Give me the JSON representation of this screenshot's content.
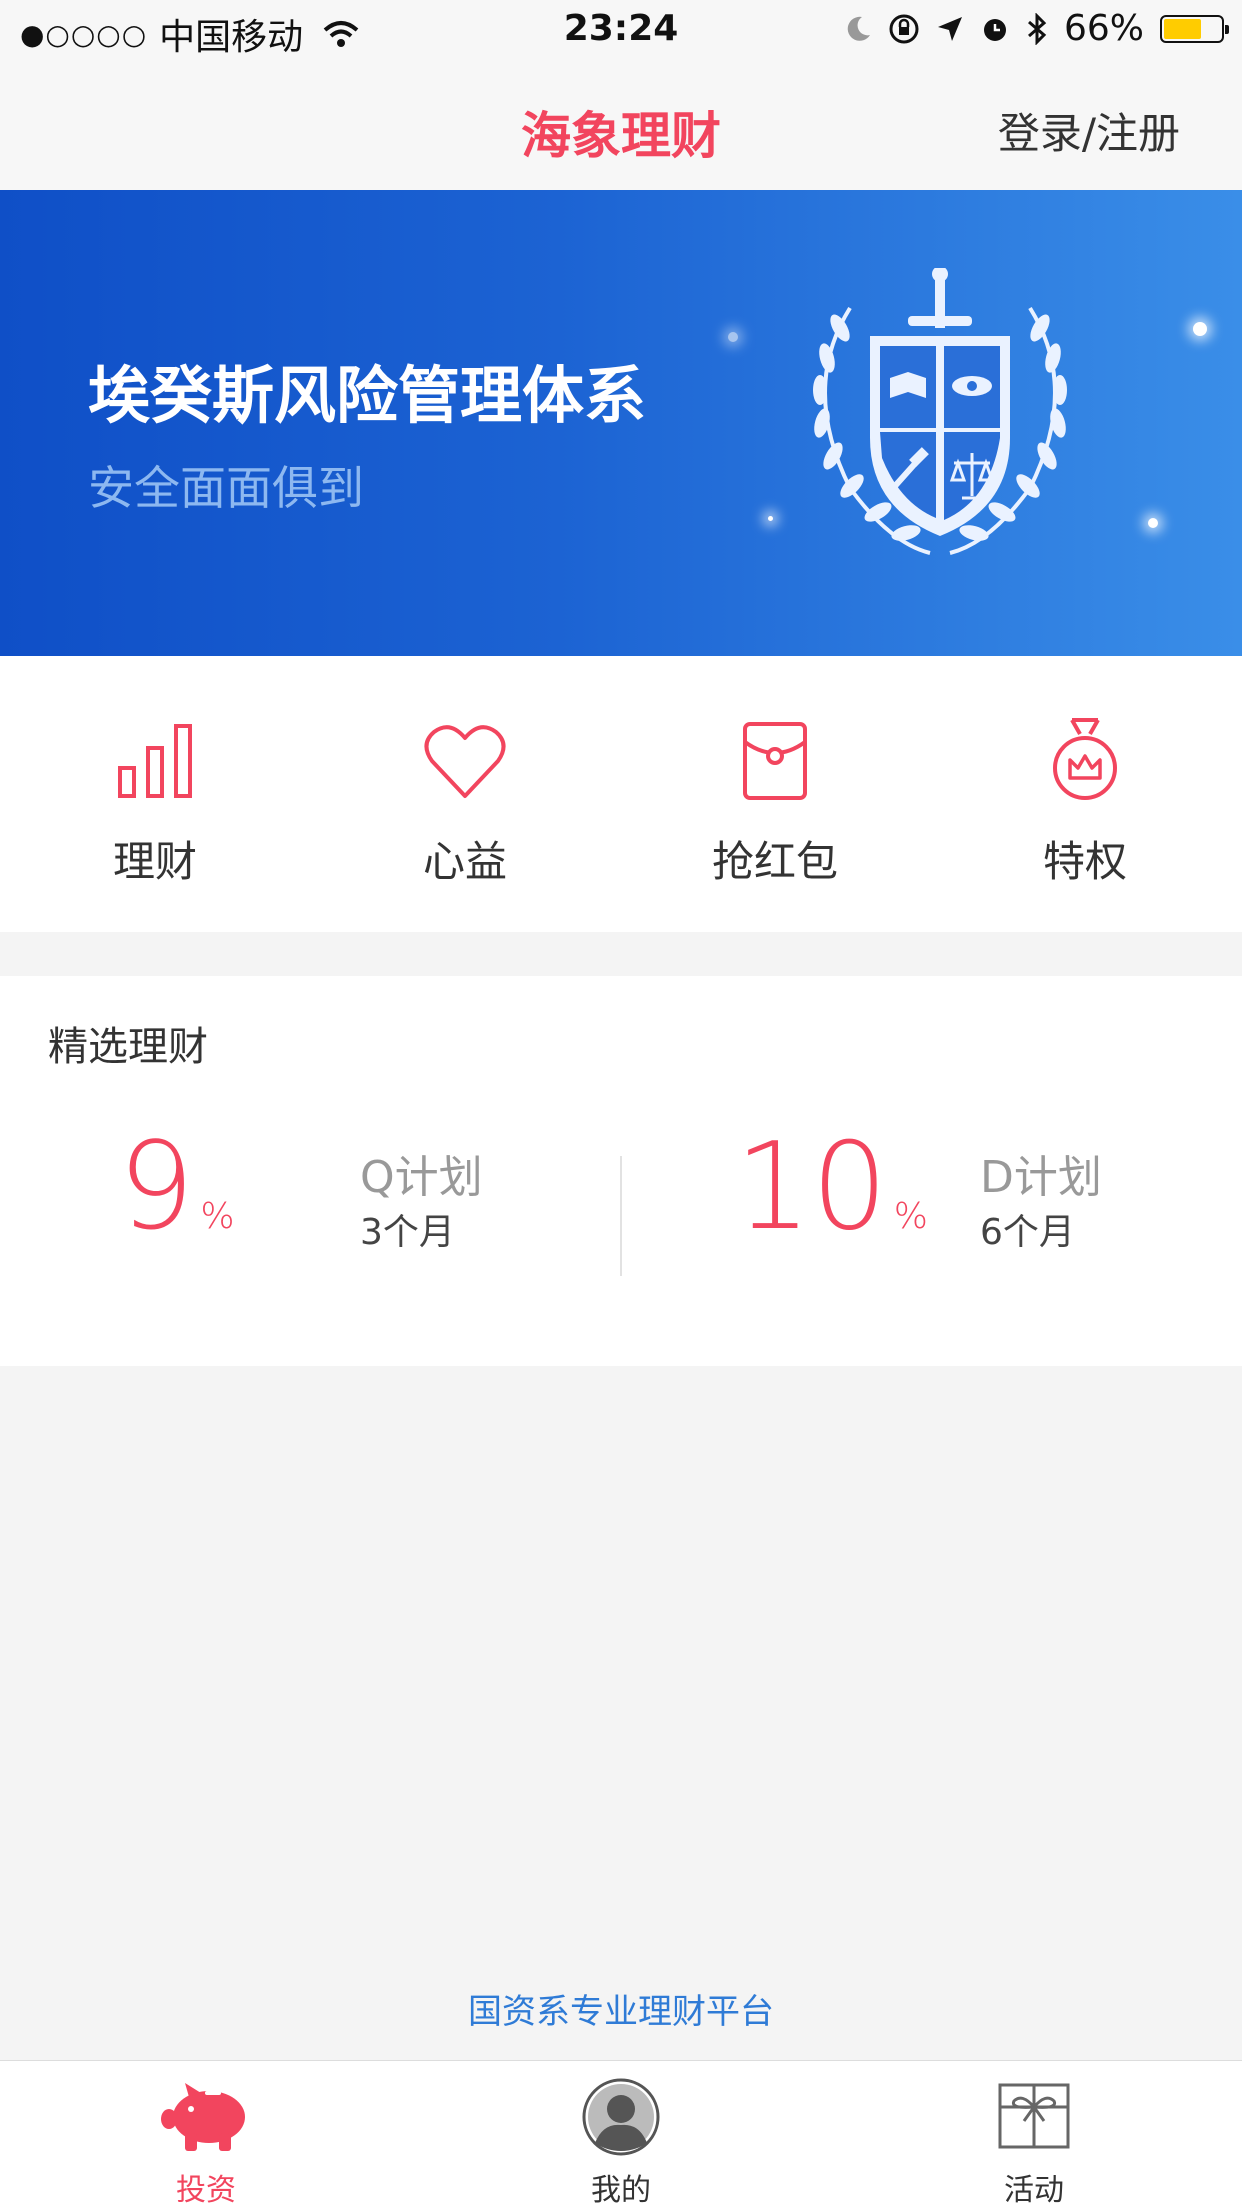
{
  "status_bar": {
    "signal": "●○○○○",
    "carrier": "中国移动",
    "time": "23:24",
    "battery": "66%",
    "battery_level": 0.66
  },
  "nav": {
    "title": "海象理财",
    "login": "登录/注册"
  },
  "banner": {
    "title": "埃癸斯风险管理体系",
    "subtitle": "安全面面俱到"
  },
  "quick_menu": [
    {
      "label": "理财",
      "icon": "bar-chart-icon"
    },
    {
      "label": "心益",
      "icon": "heart-icon"
    },
    {
      "label": "抢红包",
      "icon": "red-envelope-icon"
    },
    {
      "label": "特权",
      "icon": "crown-medal-icon"
    }
  ],
  "featured": {
    "title": "精选理财",
    "products": [
      {
        "rate": "9",
        "unit": "%",
        "name": "Q计划",
        "term": "3个月"
      },
      {
        "rate": "10",
        "unit": "%",
        "name": "D计划",
        "term": "6个月"
      }
    ]
  },
  "tagline": "国资系专业理财平台",
  "tabbar": [
    {
      "label": "投资",
      "icon": "piggy-bank-icon",
      "active": true
    },
    {
      "label": "我的",
      "icon": "user-avatar-icon",
      "active": false
    },
    {
      "label": "活动",
      "icon": "gift-icon",
      "active": false
    }
  ],
  "colors": {
    "accent": "#f2455e",
    "banner_blue": "#1c63d3",
    "link_blue": "#2f7bd6"
  }
}
